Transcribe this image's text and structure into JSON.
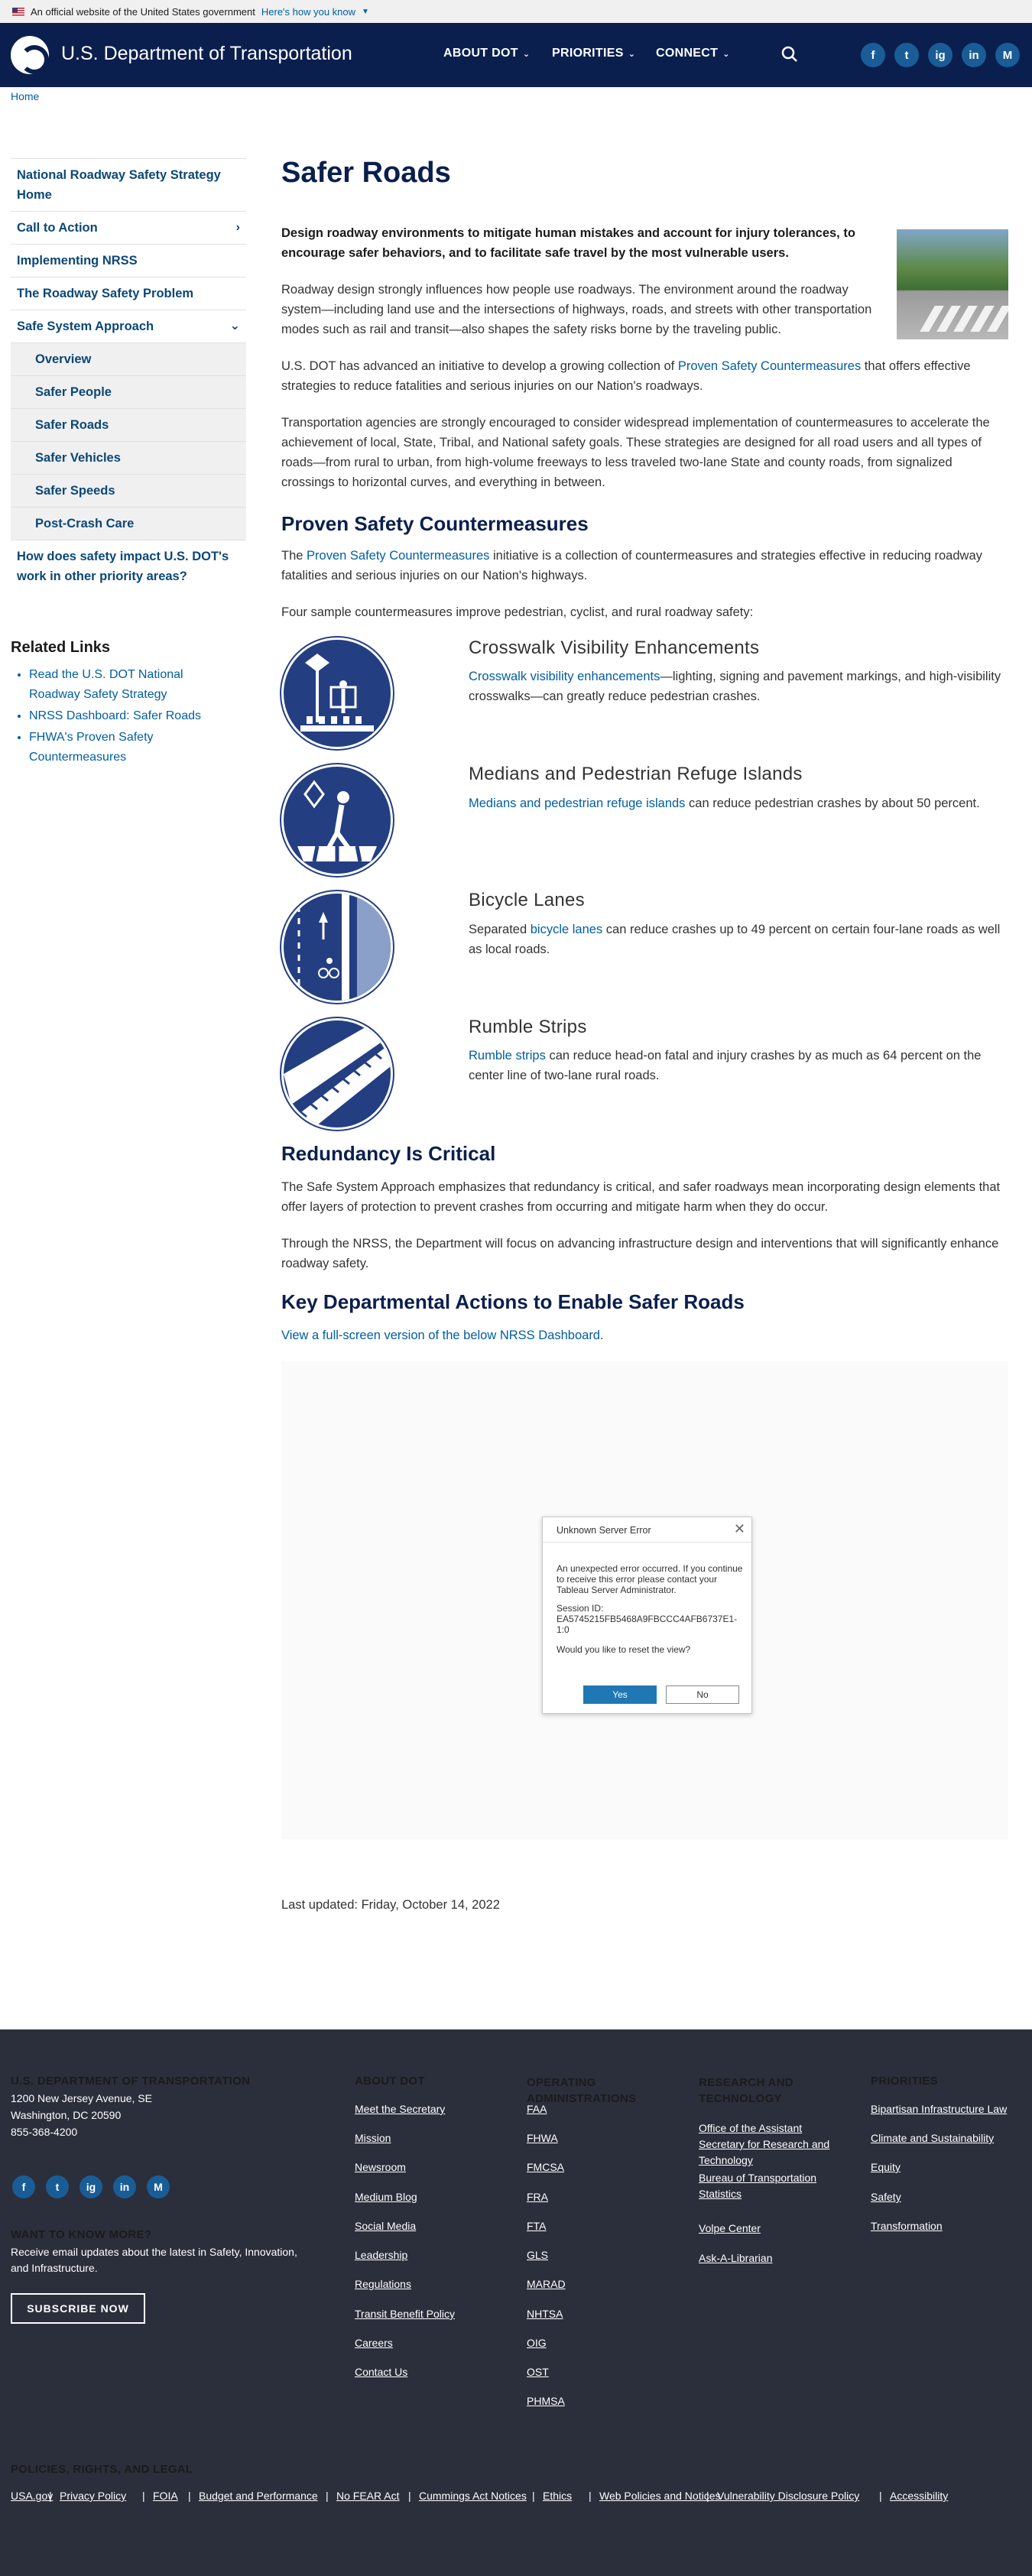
{
  "gov_banner": {
    "text": "An official website of the United States government",
    "link": "Here's how you know"
  },
  "header": {
    "site_title": "U.S. Department of Transportation",
    "nav": [
      "ABOUT DOT",
      "PRIORITIES",
      "CONNECT"
    ],
    "social": [
      "f",
      "t",
      "ig",
      "in",
      "M"
    ]
  },
  "breadcrumb": "Home",
  "sidebar": {
    "items": [
      {
        "label": "National Roadway Safety Strategy Home"
      },
      {
        "label": "Call to Action"
      },
      {
        "label": "Implementing NRSS"
      },
      {
        "label": "The Roadway Safety Problem"
      },
      {
        "label": "Safe System Approach"
      },
      {
        "label": "Overview"
      },
      {
        "label": "Safer People"
      },
      {
        "label": "Safer Roads"
      },
      {
        "label": "Safer Vehicles"
      },
      {
        "label": "Safer Speeds"
      },
      {
        "label": "Post-Crash Care"
      },
      {
        "label": "How does safety impact U.S. DOT's work in other priority areas?"
      }
    ],
    "related_title": "Related Links",
    "related": [
      "Read the U.S. DOT National Roadway Safety Strategy",
      "NRSS Dashboard: Safer Roads",
      "FHWA's Proven Safety Countermeasures"
    ]
  },
  "main": {
    "title": "Safer Roads",
    "lead": "Design roadway environments to mitigate human mistakes and account for injury tolerances, to encourage safer behaviors, and to facilitate safe travel by the most vulnerable users.",
    "p1": "Roadway design strongly influences how people use roadways. The environment around the roadway system—including land use and the intersections of highways, roads, and streets with other transportation modes such as rail and transit—also shapes the safety risks borne by the traveling public.",
    "p2_pre": "U.S. DOT has advanced an initiative to develop a growing collection of ",
    "p2_link": "Proven Safety Countermeasures",
    "p2_post": " that offers effective strategies to reduce fatalities and serious injuries on our Nation's roadways.",
    "p3": "Transportation agencies are strongly encouraged to consider widespread implementation of countermeasures to accelerate the achievement of local, State, Tribal, and National safety goals. These strategies are designed for all road users and all types of roads—from rural to urban, from high-volume freeways to less traveled two-lane State and county roads, from signalized crossings to horizontal curves, and everything in between.",
    "h2_psc": "Proven Safety Countermeasures",
    "psc_pre": "The ",
    "psc_link": "Proven Safety Countermeasures",
    "psc_post": " initiative is a collection of countermeasures and strategies effective in reducing roadway fatalities and serious injuries on our Nation's highways.",
    "psc_intro": "Four sample countermeasures improve pedestrian, cyclist, and rural roadway safety:",
    "countermeasures": [
      {
        "title": "Crosswalk Visibility Enhancements",
        "link": "Crosswalk visibility enhancements",
        "text": "—lighting, signing and pavement markings, and high-visibility crosswalks—can greatly reduce pedestrian crashes."
      },
      {
        "title": "Medians and Pedestrian Refuge Islands",
        "link": "Medians and pedestrian refuge islands",
        "text": " can reduce pedestrian crashes by about 50 percent."
      },
      {
        "title": "Bicycle Lanes",
        "pre": "Separated ",
        "link": "bicycle lanes",
        "text": " can reduce crashes up to 49 percent on certain four-lane roads as well as local roads."
      },
      {
        "title": "Rumble Strips",
        "link": "Rumble strips",
        "text": " can reduce head-on fatal and injury crashes by as much as 64 percent on the center line of two-lane rural roads."
      }
    ],
    "h2_redundancy": "Redundancy Is Critical",
    "red_p1": "The Safe System Approach emphasizes that redundancy is critical, and safer roadways mean incorporating design elements that offer layers of protection to prevent crashes from occurring and mitigate harm when they do occur.",
    "red_p2": "Through the NRSS, the Department will focus on advancing infrastructure design and interventions that will significantly enhance roadway safety.",
    "h2_key": "Key Departmental Actions to Enable Safer Roads",
    "key_link": "View a full-screen version of the below NRSS Dashboard",
    "key_link_end": ".",
    "last_updated": "Last updated: Friday, October 14, 2022"
  },
  "dialog": {
    "title": "Unknown Server Error",
    "body": "An unexpected error occurred. If you continue to receive this error please contact your Tableau Server Administrator.",
    "session_label": "Session ID:",
    "session_id": "EA5745215FB5468A9FBCCC4AFB6737E1-1:0",
    "question": "Would you like to reset the view?",
    "yes": "Yes",
    "no": "No"
  },
  "footer": {
    "org": "U.S. DEPARTMENT OF TRANSPORTATION",
    "addr1": "1200 New Jersey Avenue, SE",
    "addr2": "Washington, DC 20590",
    "phone": "855-368-4200",
    "want_title": "WANT TO KNOW MORE?",
    "want_text": "Receive email updates about the latest in Safety, Innovation, and Infrastructure.",
    "subscribe": "SUBSCRIBE NOW",
    "about_title": "ABOUT DOT",
    "about": [
      "Meet the Secretary",
      "Mission",
      "Newsroom",
      "Medium Blog",
      "Social Media",
      "Leadership",
      "Regulations",
      "Transit Benefit Policy",
      "Careers",
      "Contact Us"
    ],
    "op_title": "OPERATING ADMINISTRATIONS",
    "op": [
      "FAA",
      "FHWA",
      "FMCSA",
      "FRA",
      "FTA",
      "GLS",
      "MARAD",
      "NHTSA",
      "OIG",
      "OST",
      "PHMSA"
    ],
    "rt_title": "RESEARCH AND TECHNOLOGY",
    "rt": [
      "Office of the Assistant Secretary for Research and Technology",
      "Bureau of Transportation Statistics",
      "Volpe Center",
      "Ask-A-Librarian"
    ],
    "pr_title": "PRIORITIES",
    "pr": [
      "Bipartisan Infrastructure Law",
      "Climate and Sustainability",
      "Equity",
      "Safety",
      "Transformation"
    ],
    "policies_title": "POLICIES, RIGHTS, AND LEGAL",
    "policies": [
      "USA.gov",
      "Privacy Policy",
      "FOIA",
      "Budget and Performance",
      "No FEAR Act",
      "Cummings Act Notices",
      "Ethics",
      "Web Policies and Notices",
      "Vulnerability Disclosure Policy",
      "Accessibility"
    ]
  },
  "colors": {
    "navy": "#0b1f4e",
    "link": "#005ea2",
    "footer": "#2b2f3c",
    "icon_blue": "#243e82"
  }
}
